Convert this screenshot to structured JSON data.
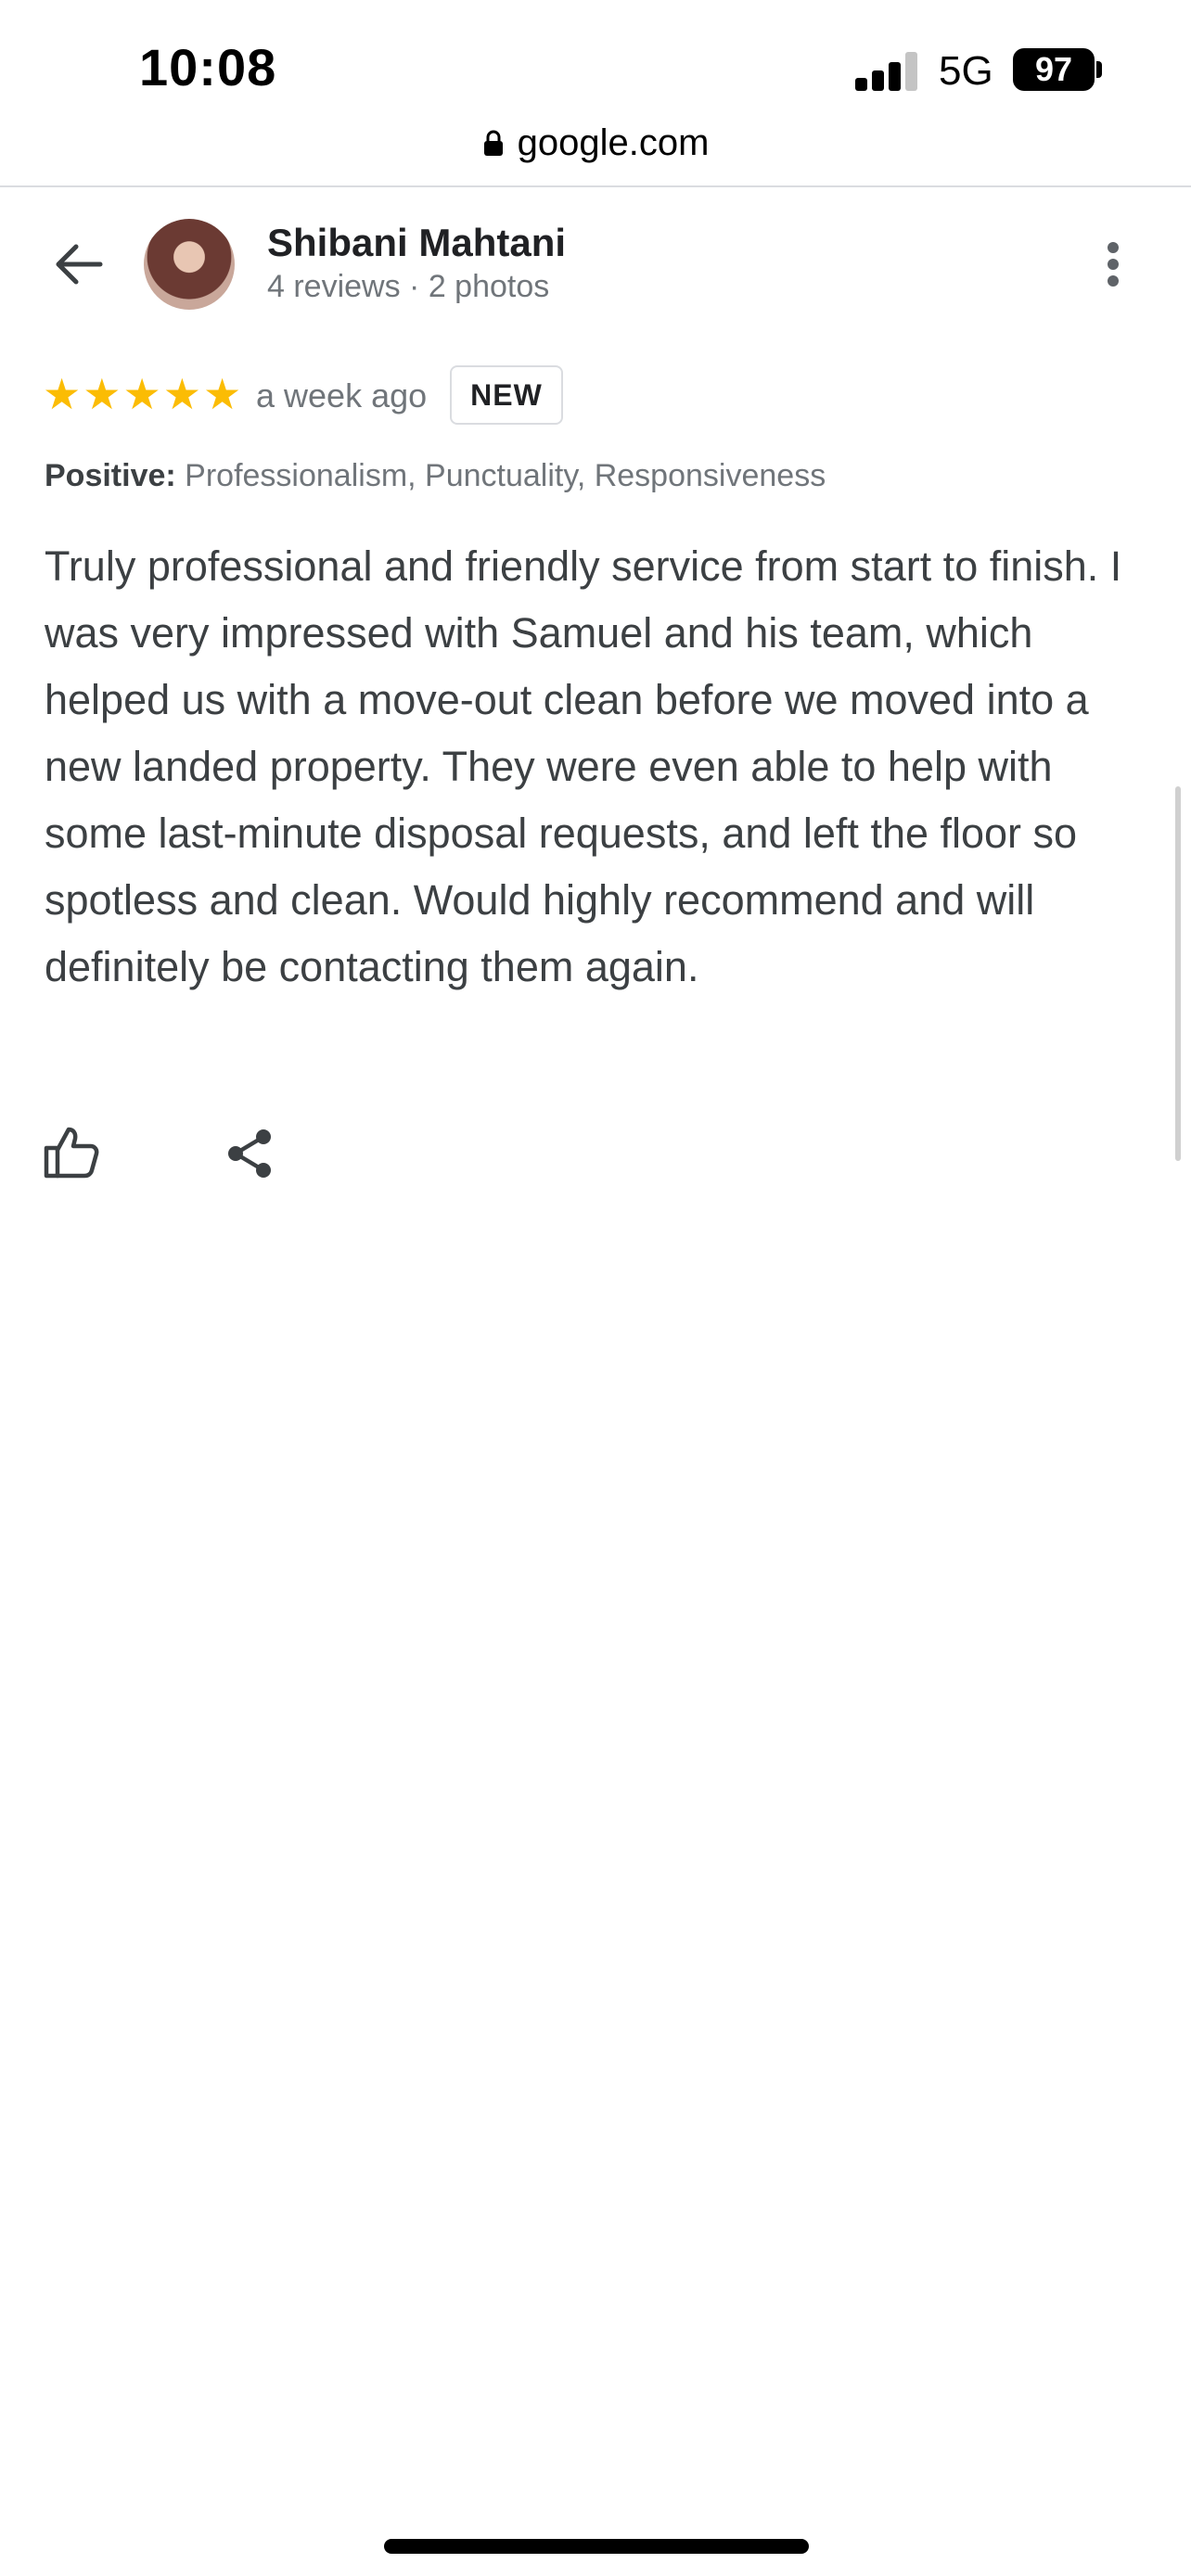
{
  "status_bar": {
    "time": "10:08",
    "network": "5G",
    "battery": "97"
  },
  "browser": {
    "url": "google.com",
    "lock_icon": "lock-icon"
  },
  "reviewer": {
    "name": "Shibani Mahtani",
    "meta": "4 reviews · 2 photos",
    "avatar_icon": "avatar-photo"
  },
  "review": {
    "rating": 5,
    "max_rating": 5,
    "stars": "★★★★★",
    "date": "a week ago",
    "badge": "NEW",
    "positive_label": "Positive:",
    "positive_values": "Professionalism, Punctuality, Responsiveness",
    "text": "Truly professional and friendly service from start to finish. I was very impressed with Samuel and his team, which helped us with a move-out clean before we moved into a new landed property. They were even able to help with some last-minute disposal requests, and left the floor so spotless and clean. Would highly recommend and will definitely be contacting them again."
  },
  "actions": {
    "like_icon": "thumbs-up-icon",
    "share_icon": "share-icon",
    "back_icon": "arrow-left-icon",
    "more_icon": "more-vertical-icon"
  },
  "colors": {
    "star": "#fbbc04",
    "primary_text": "#202124",
    "secondary_text": "#70757a",
    "body_text": "#3c4043"
  }
}
